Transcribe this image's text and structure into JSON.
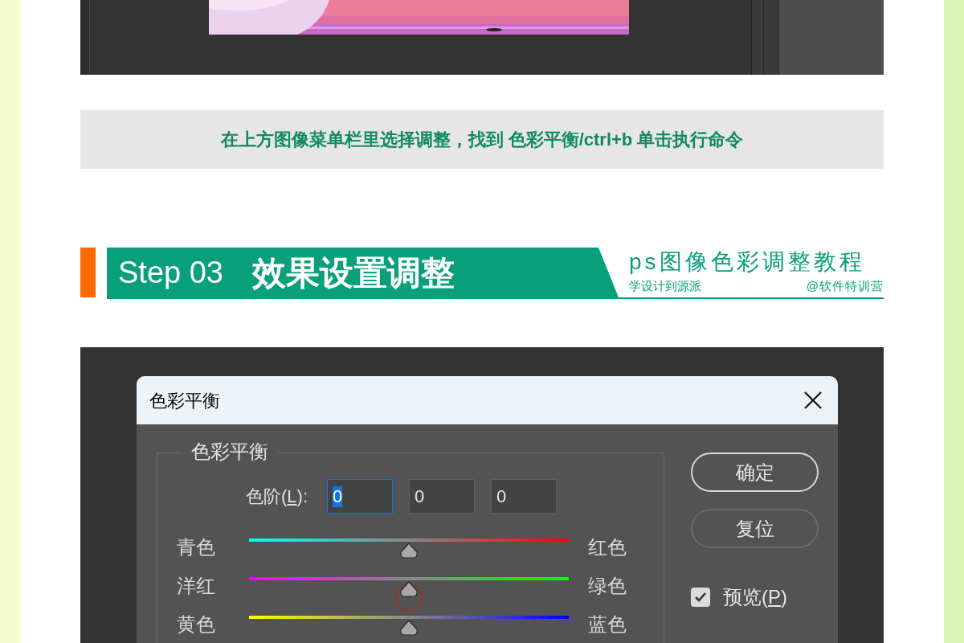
{
  "caption": {
    "text": "在上方图像菜单栏里选择调整，找到 色彩平衡/ctrl+b 单击执行命令"
  },
  "step_header": {
    "step": "Step 03",
    "title": "效果设置调整",
    "series_title": "ps图像色彩调整教程",
    "left_tag": "学设计到源派",
    "right_tag": "@软件特训营"
  },
  "dialog": {
    "title": "色彩平衡",
    "group_label": "色彩平衡",
    "levels": {
      "label_before": "色阶(",
      "access_key": "L",
      "label_after": "):",
      "fields": [
        {
          "value": "0",
          "focused": true
        },
        {
          "value": "0",
          "focused": false
        },
        {
          "value": "0",
          "focused": false
        }
      ]
    },
    "sliders": [
      {
        "left": "青色",
        "right": "红色",
        "level": 0.5,
        "highlighted": false
      },
      {
        "left": "洋红",
        "right": "绿色",
        "level": 0.5,
        "highlighted": true
      },
      {
        "left": "黄色",
        "right": "蓝色",
        "level": 0.5,
        "highlighted": false
      }
    ],
    "buttons": [
      {
        "label": "确定",
        "default": true
      },
      {
        "label": "复位",
        "default": false
      }
    ],
    "preview": {
      "label_before": "预览(",
      "access_key": "P",
      "label_after": ")",
      "checked": true
    }
  }
}
